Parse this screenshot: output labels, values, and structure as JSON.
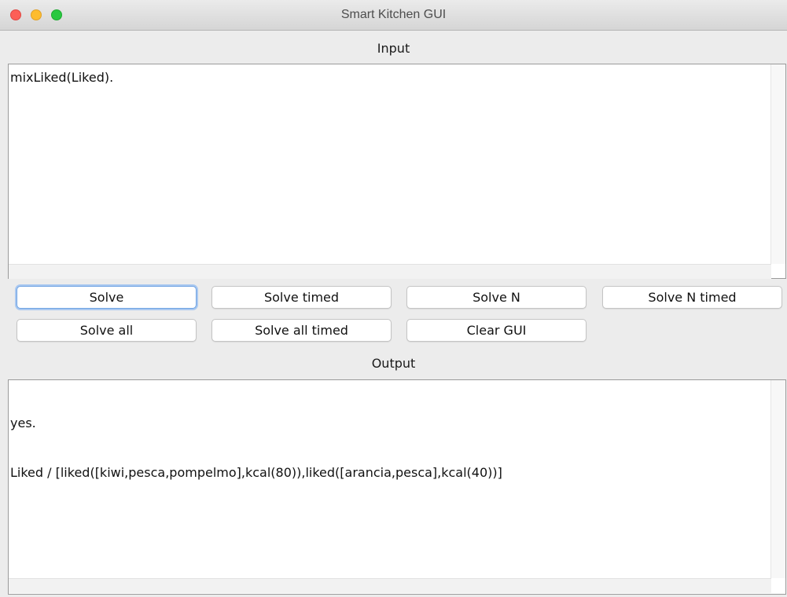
{
  "window": {
    "title": "Smart Kitchen GUI"
  },
  "input": {
    "label": "Input",
    "text": "mixLiked(Liked)."
  },
  "buttons": {
    "solve": "Solve",
    "solve_timed": "Solve timed",
    "solve_n": "Solve N",
    "solve_n_timed": "Solve N timed",
    "solve_all": "Solve all",
    "solve_all_timed": "Solve all timed",
    "clear_gui": "Clear GUI"
  },
  "output": {
    "label": "Output",
    "lines": [
      "yes.",
      "Liked / [liked([kiwi,pesca,pompelmo],kcal(80)),liked([arancia,pesca],kcal(40))]"
    ]
  },
  "colors": {
    "close": "#fc5f57",
    "minimize": "#fdbc2e",
    "maximize": "#28c840",
    "focus_ring": "#a9c8f0"
  }
}
